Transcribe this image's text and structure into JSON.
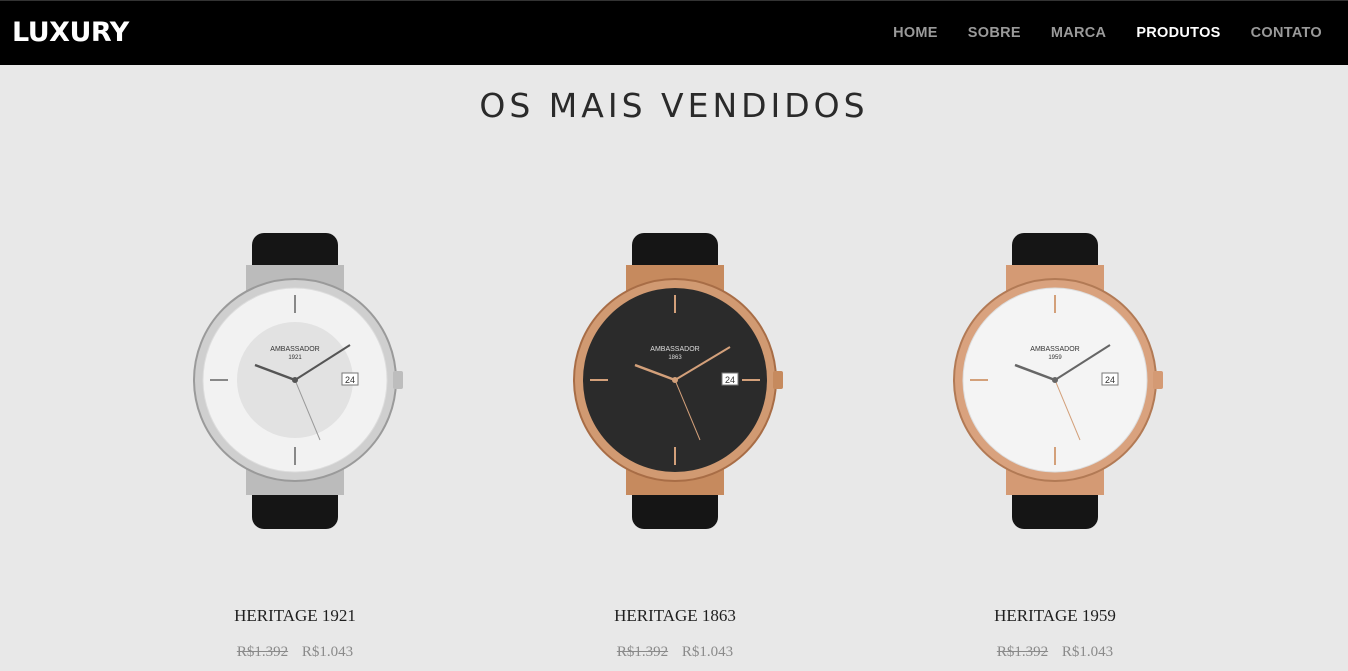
{
  "brand": "LUXURY",
  "nav": [
    {
      "label": "HOME",
      "active": false
    },
    {
      "label": "SOBRE",
      "active": false
    },
    {
      "label": "MARCA",
      "active": false
    },
    {
      "label": "PRODUTOS",
      "active": true
    },
    {
      "label": "CONTATO",
      "active": false
    }
  ],
  "section_title": "OS MAIS VENDIDOS",
  "products": [
    {
      "name": "HERITAGE 1921",
      "old_price": "R$1.392",
      "price": "R$1.043",
      "dial_brand": "AMBASSADOR",
      "dial_year": "1921",
      "date": "24",
      "case_color": "#c8c8c8",
      "dial_color": "#f0f0f0"
    },
    {
      "name": "HERITAGE 1863",
      "old_price": "R$1.392",
      "price": "R$1.043",
      "dial_brand": "AMBASSADOR",
      "dial_year": "1863",
      "date": "24",
      "case_color": "#d19a72",
      "dial_color": "#2b2b2b"
    },
    {
      "name": "HERITAGE 1959",
      "old_price": "R$1.392",
      "price": "R$1.043",
      "dial_brand": "AMBASSADOR",
      "dial_year": "1959",
      "date": "24",
      "case_color": "#d9a27e",
      "dial_color": "#f4f4f4"
    }
  ]
}
